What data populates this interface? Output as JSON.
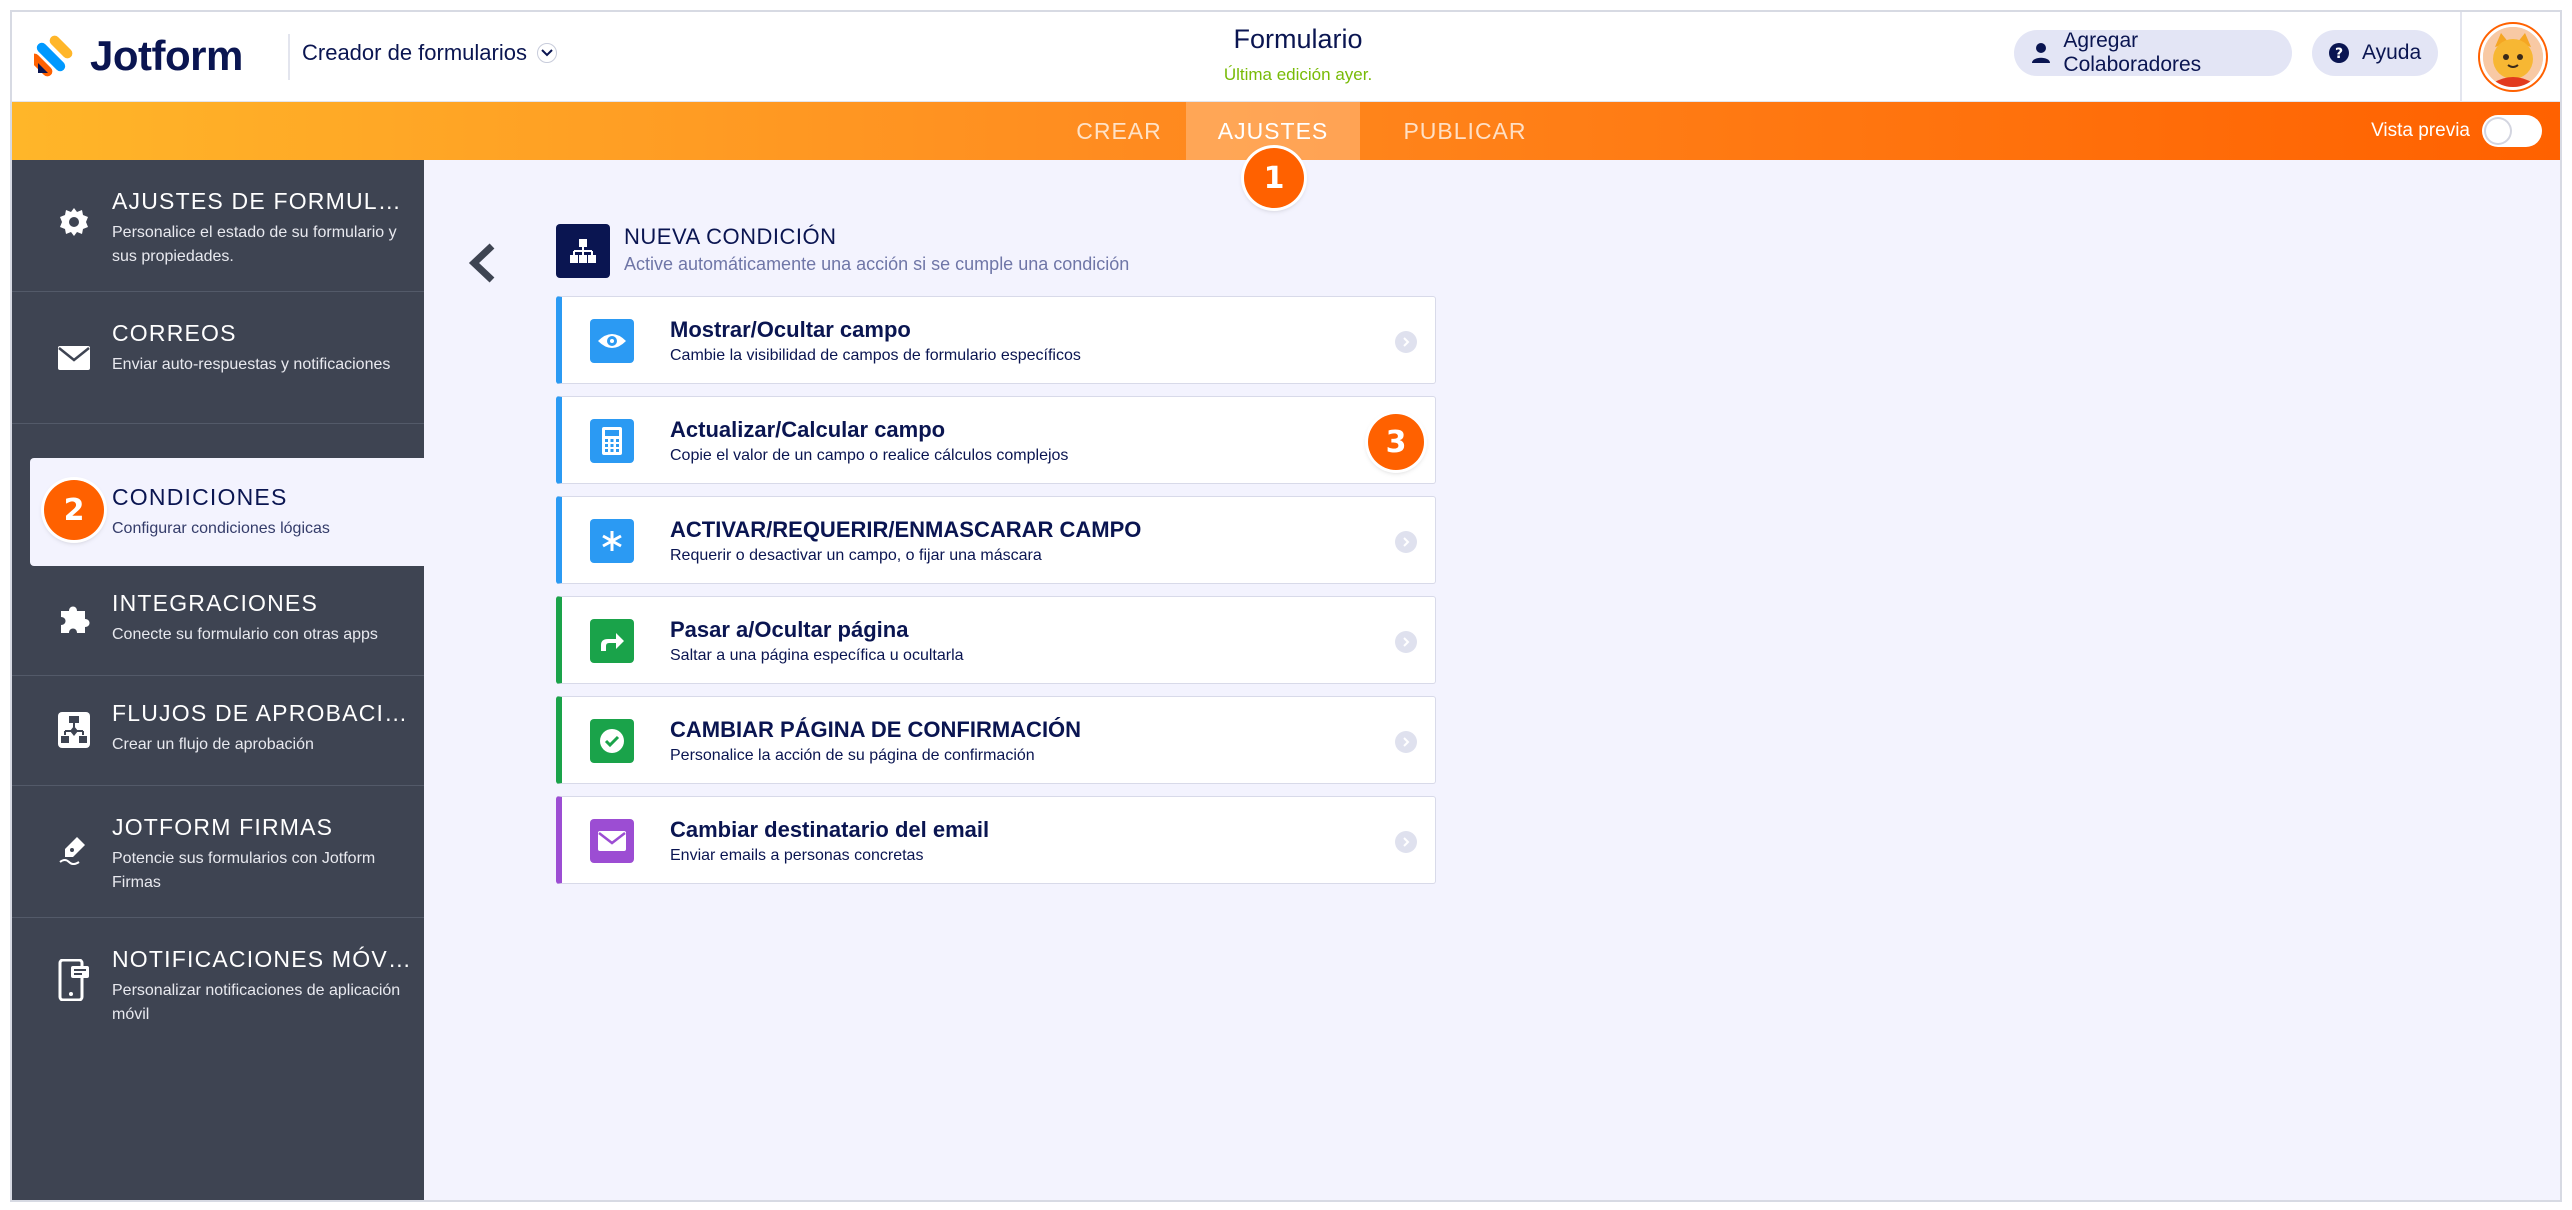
{
  "header": {
    "logo_text": "Jotform",
    "builder_label": "Creador de formularios",
    "form_title": "Formulario",
    "last_edit": "Última edición ayer.",
    "collaborators_label": "Agregar Colaboradores",
    "help_label": "Ayuda"
  },
  "nav": {
    "tabs": [
      {
        "label": "CREAR"
      },
      {
        "label": "AJUSTES"
      },
      {
        "label": "PUBLICAR"
      }
    ],
    "active_tab": "AJUSTES",
    "preview_label": "Vista previa",
    "preview_on": false
  },
  "sidebar": {
    "items": [
      {
        "title": "AJUSTES DE FORMULARIO",
        "desc": "Personalice el estado de su formulario y sus propiedades.",
        "icon": "gear-icon"
      },
      {
        "title": "CORREOS",
        "desc": "Enviar auto-respuestas y notificaciones",
        "icon": "envelope-icon"
      },
      {
        "title": "CONDICIONES",
        "desc": "Configurar condiciones lógicas",
        "icon": "conditions-icon"
      },
      {
        "title": "INTEGRACIONES",
        "desc": "Conecte su formulario con otras apps",
        "icon": "puzzle-icon"
      },
      {
        "title": "FLUJOS DE APROBACIÓN",
        "desc": "Crear un flujo de aprobación",
        "icon": "approval-flow-icon"
      },
      {
        "title": "JOTFORM FIRMAS",
        "desc": "Potencie sus formularios con Jotform Firmas",
        "icon": "signature-pen-icon"
      },
      {
        "title": "NOTIFICACIONES MÓVILES",
        "desc": "Personalizar notificaciones de aplicación móvil",
        "icon": "mobile-notification-icon"
      }
    ],
    "active_item": "CONDICIONES"
  },
  "main": {
    "new_condition_title": "NUEVA CONDICIÓN",
    "new_condition_desc": "Active automáticamente una acción si se cumple una condición",
    "cards": [
      {
        "title": "Mostrar/Ocultar campo",
        "desc": "Cambie la visibilidad de campos de formulario específicos",
        "color": "#2b9af3",
        "icon": "eye-icon"
      },
      {
        "title": "Actualizar/Calcular campo",
        "desc": "Copie el valor de un campo o realice cálculos complejos",
        "color": "#2b9af3",
        "icon": "calculator-icon"
      },
      {
        "title": "ACTIVAR/REQUERIR/ENMASCARAR CAMPO",
        "desc": "Requerir o desactivar un campo, o fijar una máscara",
        "color": "#2b9af3",
        "icon": "asterisk-icon"
      },
      {
        "title": "Pasar a/Ocultar página",
        "desc": "Saltar a una página específica u ocultarla",
        "color": "#1aa34a",
        "icon": "skip-arrow-icon"
      },
      {
        "title": "CAMBIAR PÁGINA DE CONFIRMACIÓN",
        "desc": "Personalice la acción de su página de confirmación",
        "color": "#1aa34a",
        "icon": "check-circle-icon"
      },
      {
        "title": "Cambiar destinatario del email",
        "desc": "Enviar emails a personas concretas",
        "color": "#9c4dd3",
        "icon": "envelope-icon"
      }
    ]
  },
  "callouts": {
    "step1": "1",
    "step2": "2",
    "step3": "3"
  },
  "colors": {
    "brand_orange": "#ff6100",
    "nav_gradient_start": "#ffb629",
    "sidebar_bg": "#3e4452",
    "text_navy": "#0a1551",
    "success_green": "#78bb07"
  }
}
